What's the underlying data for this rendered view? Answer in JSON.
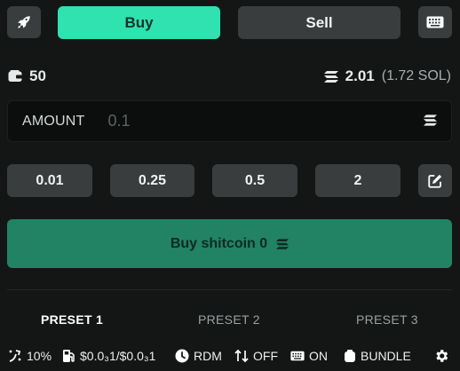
{
  "top": {
    "buy_label": "Buy",
    "sell_label": "Sell",
    "rocket_icon": "rocket-icon",
    "keyboard_icon": "keyboard-icon",
    "active_tab": "Buy"
  },
  "balances": {
    "wallet_count": "50",
    "sol_balance": "2.01",
    "sol_balance_detail": "(1.72 SOL)"
  },
  "amount": {
    "label": "AMOUNT",
    "placeholder": "0.1",
    "value": ""
  },
  "quick_amounts": [
    "0.01",
    "0.25",
    "0.5",
    "2"
  ],
  "buy_button": {
    "label": "Buy shitcoin 0"
  },
  "presets": {
    "tabs": [
      "PRESET 1",
      "PRESET 2",
      "PRESET 3"
    ],
    "active": "PRESET 1"
  },
  "status_bar": {
    "slippage": "10%",
    "fee": "$0.0₃1/$0.0₃1",
    "mode": "RDM",
    "autosell": "OFF",
    "keyboard": "ON",
    "bundle": "BUNDLE"
  },
  "colors": {
    "buy_accent": "#2fe2b0",
    "buy_main": "#228264",
    "background": "#141616",
    "button_gray": "#3a3d3d"
  }
}
